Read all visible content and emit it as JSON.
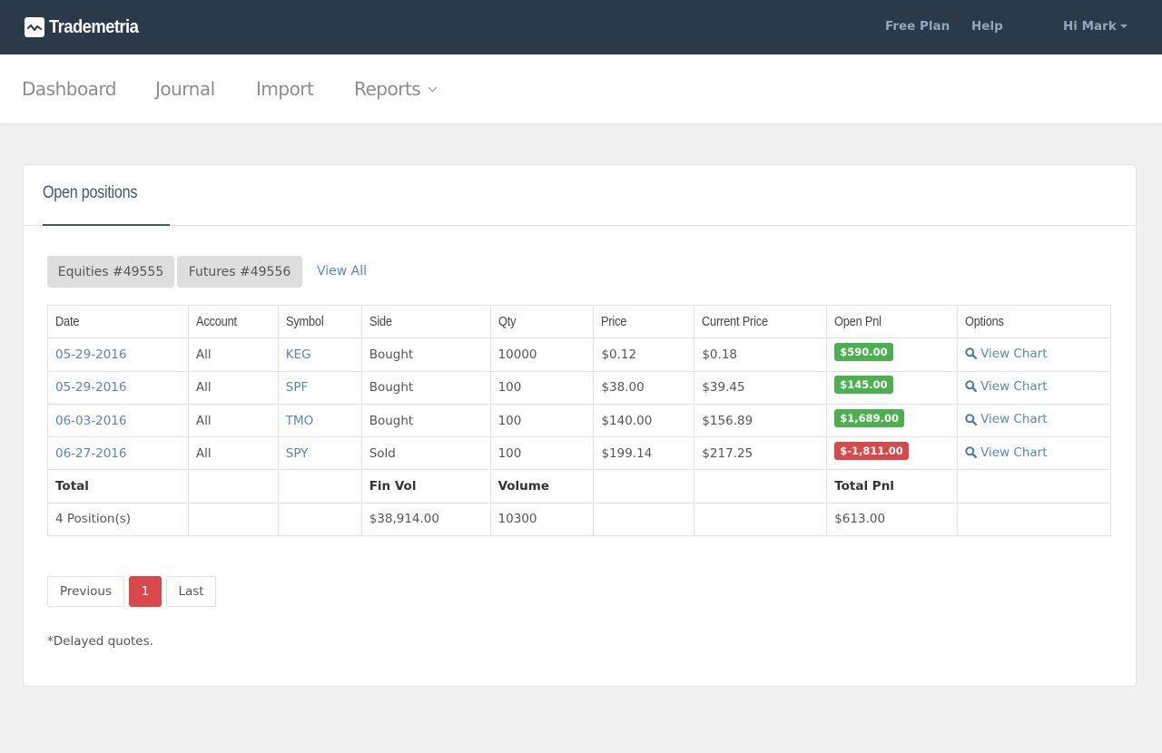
{
  "topbar": {
    "brand": "Trademetria",
    "brand_icon": "line-chart-icon",
    "links": [
      {
        "label": "Free Plan"
      },
      {
        "label": "Help"
      },
      {
        "label": "Hi Mark",
        "icon": "caret-down-icon"
      }
    ]
  },
  "subnav": {
    "items": [
      {
        "label": "Dashboard"
      },
      {
        "label": "Journal"
      },
      {
        "label": "Import"
      },
      {
        "label": "Reports",
        "icon": "chevron-down-icon"
      }
    ]
  },
  "panel": {
    "title": "Open positions",
    "accounts": [
      {
        "label": "Equities #49555"
      },
      {
        "label": "Futures #49556"
      }
    ],
    "view_all": "View All",
    "table": {
      "columns": [
        "Date",
        "Account",
        "Symbol",
        "Side",
        "Qty",
        "Price",
        "Current Price",
        "Open Pnl",
        "Options"
      ],
      "rows": [
        {
          "date": "05-29-2016",
          "account": "All",
          "symbol": "KEG",
          "side": "Bought",
          "qty": "10000",
          "price": "$0.12",
          "current_price": "$0.18",
          "open_pnl": "$590.00",
          "pnl_sign": "positive",
          "option": "View Chart"
        },
        {
          "date": "05-29-2016",
          "account": "All",
          "symbol": "SPF",
          "side": "Bought",
          "qty": "100",
          "price": "$38.00",
          "current_price": "$39.45",
          "open_pnl": "$145.00",
          "pnl_sign": "positive",
          "option": "View Chart"
        },
        {
          "date": "06-03-2016",
          "account": "All",
          "symbol": "TMO",
          "side": "Bought",
          "qty": "100",
          "price": "$140.00",
          "current_price": "$156.89",
          "open_pnl": "$1,689.00",
          "pnl_sign": "positive",
          "option": "View Chart"
        },
        {
          "date": "06-27-2016",
          "account": "All",
          "symbol": "SPY",
          "side": "Sold",
          "qty": "100",
          "price": "$199.14",
          "current_price": "$217.25",
          "open_pnl": "$-1,811.00",
          "pnl_sign": "negative",
          "option": "View Chart"
        }
      ],
      "totals_header": {
        "label": "Total",
        "fin_vol": "Fin Vol",
        "volume": "Volume",
        "total_pnl": "Total Pnl"
      },
      "totals": {
        "positions": "4 Position(s)",
        "fin_vol": "$38,914.00",
        "volume": "10300",
        "total_pnl": "$613.00"
      }
    },
    "pagination": {
      "previous": "Previous",
      "current": "1",
      "last": "Last"
    },
    "note": "*Delayed quotes."
  },
  "colors": {
    "topbar_bg": "#2b3a4a",
    "accent": "#5b86b3",
    "positive": "#4cb051",
    "negative": "#d9494c"
  }
}
